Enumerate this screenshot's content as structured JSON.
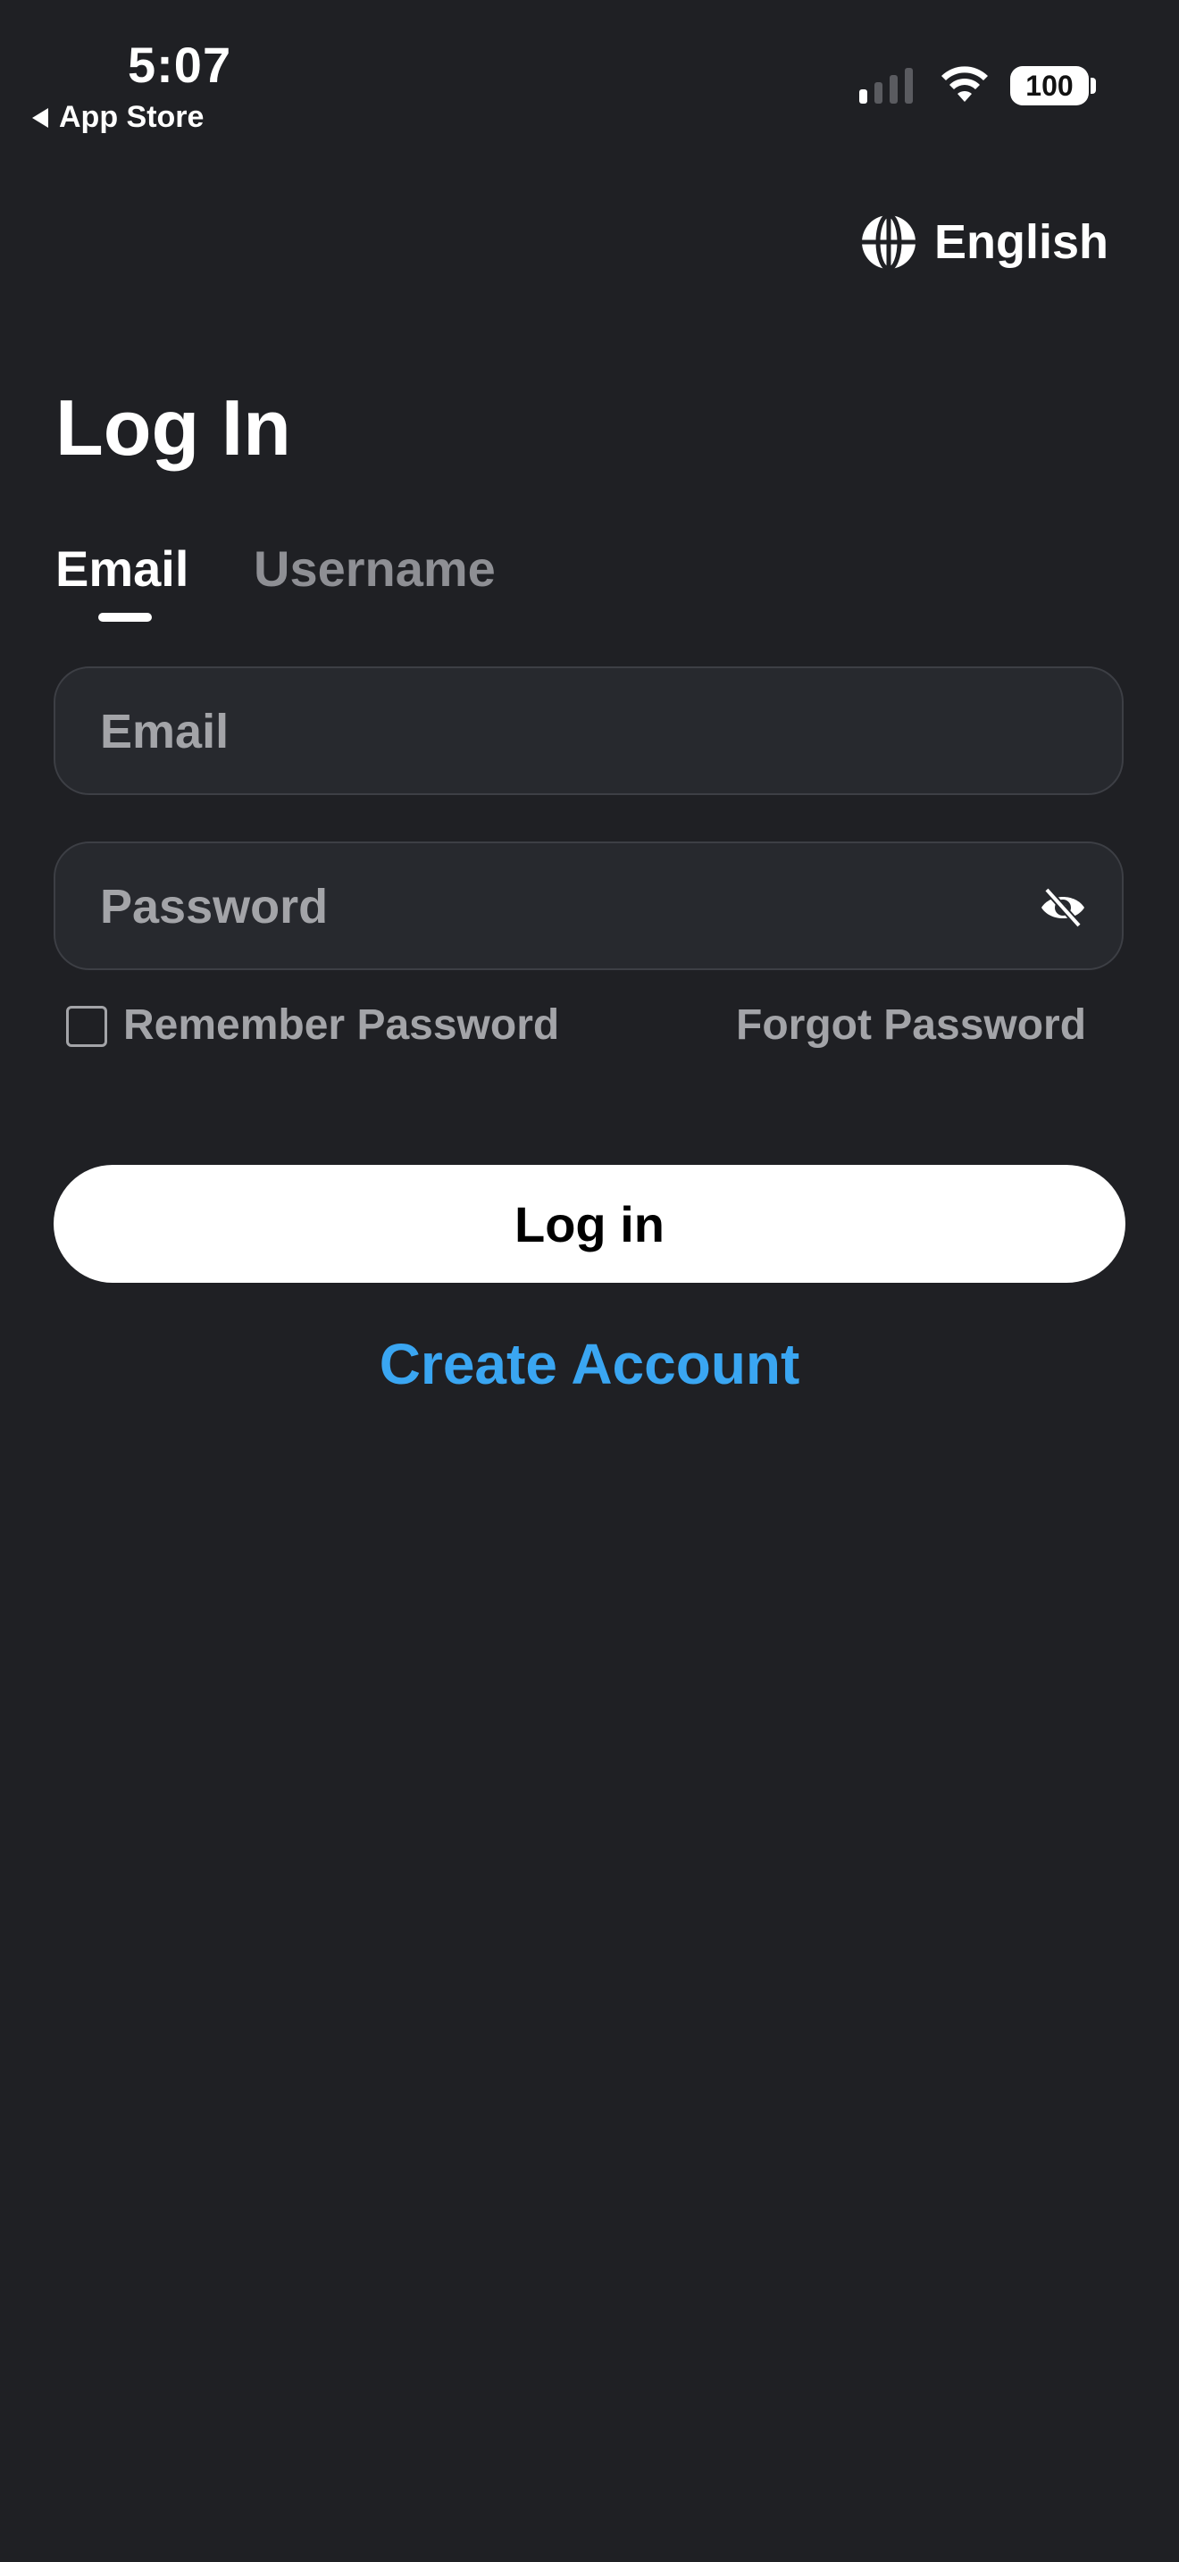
{
  "status_bar": {
    "time": "5:07",
    "back_label": "App Store",
    "battery": "100",
    "signal_bars_active": 1,
    "signal_bars_total": 4
  },
  "language": {
    "label": "English",
    "icon": "globe-icon"
  },
  "page": {
    "title": "Log In"
  },
  "tabs": [
    {
      "label": "Email",
      "active": true
    },
    {
      "label": "Username",
      "active": false
    }
  ],
  "form": {
    "email_placeholder": "Email",
    "email_value": "",
    "password_placeholder": "Password",
    "password_value": "",
    "password_toggle_icon": "eye-off-icon",
    "remember_label": "Remember Password",
    "remember_checked": false,
    "forgot_label": "Forgot Password"
  },
  "actions": {
    "login_label": "Log in",
    "create_label": "Create Account"
  },
  "colors": {
    "background": "#1f2024",
    "field_background": "#27292e",
    "muted_text": "#a3a4a8",
    "link": "#3aa6f2",
    "button": "#ffffff"
  }
}
